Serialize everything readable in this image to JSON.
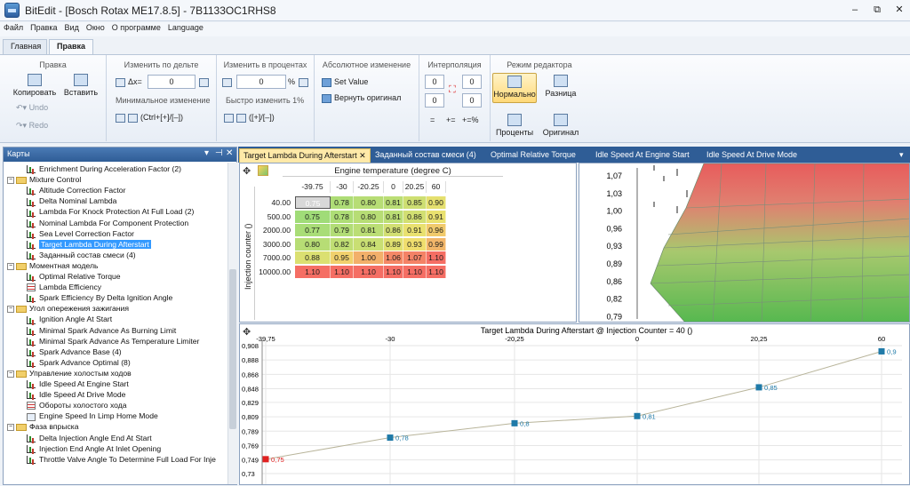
{
  "window": {
    "title": "BitEdit - [Bosch Rotax ME17.8.5] - 7B1133OC1RHS8",
    "min": "–",
    "restore": "⧉",
    "close": "✕"
  },
  "menu": [
    "Файл",
    "Правка",
    "Вид",
    "Окно",
    "О программе",
    "Language"
  ],
  "ribbon_tabs": [
    "Главная",
    "Правка"
  ],
  "ribbon": {
    "edit": {
      "title": "Правка",
      "copy": "Копировать",
      "paste": "Вставить",
      "undo": "Undo",
      "redo": "Redo"
    },
    "delta": {
      "title": "Изменить по дельте",
      "dx": "Δx=",
      "value": "0",
      "min_title": "Минимальное изменение",
      "shortcut": "(Ctrl+[+]/[–])"
    },
    "percent": {
      "title": "Изменить в процентах",
      "value": "0",
      "unit": "%",
      "quick_title": "Быстро изменить 1%",
      "shortcut": "([+]/[–])"
    },
    "absolute": {
      "title": "Абсолютное изменение",
      "set": "Set Value",
      "revert": "Вернуть оригинал"
    },
    "interp": {
      "title": "Интерполяция",
      "a": "0",
      "b": "0",
      "c": "0",
      "d": "0",
      "eq1": "=",
      "eq2": "+=",
      "eq3": "+=%"
    },
    "mode": {
      "title": "Режим редактора",
      "normal": "Нормально",
      "diff": "Разница",
      "percent": "Проценты",
      "orig": "Оригинал"
    }
  },
  "maps_panel": {
    "title": "Карты",
    "items": [
      {
        "t": "Enrichment During Acceleration Factor (2)",
        "lvl": 2,
        "icon": "chart"
      },
      {
        "t": "Mixture Control",
        "lvl": 1,
        "icon": "folder"
      },
      {
        "t": "Altitude Correction Factor",
        "lvl": 2,
        "icon": "chart"
      },
      {
        "t": "Delta Nominal Lambda",
        "lvl": 2,
        "icon": "chart"
      },
      {
        "t": "Lambda For Knock Protection At Full Load (2)",
        "lvl": 2,
        "icon": "chart"
      },
      {
        "t": "Nominal Lambda For Component Protection",
        "lvl": 2,
        "icon": "chart"
      },
      {
        "t": "Sea Level Correction Factor",
        "lvl": 2,
        "icon": "chart"
      },
      {
        "t": "Target Lambda During Afterstart",
        "lvl": 2,
        "icon": "chart",
        "sel": true
      },
      {
        "t": "Заданный состав смеси (4)",
        "lvl": 2,
        "icon": "chart"
      },
      {
        "t": "Моментная модель",
        "lvl": 1,
        "icon": "folder"
      },
      {
        "t": "Optimal Relative Torque",
        "lvl": 2,
        "icon": "chart"
      },
      {
        "t": "Lambda Efficiency",
        "lvl": 2,
        "icon": "table"
      },
      {
        "t": "Spark Efficiency By Delta Ignition Angle",
        "lvl": 2,
        "icon": "chart"
      },
      {
        "t": "Угол опережения зажигания",
        "lvl": 1,
        "icon": "folder"
      },
      {
        "t": "Ignition Angle At Start",
        "lvl": 2,
        "icon": "chart"
      },
      {
        "t": "Minimal Spark Advance As Burning Limit",
        "lvl": 2,
        "icon": "chart"
      },
      {
        "t": "Minimal Spark Advance As Temperature Limiter",
        "lvl": 2,
        "icon": "chart"
      },
      {
        "t": "Spark Advance Base (4)",
        "lvl": 2,
        "icon": "chart"
      },
      {
        "t": "Spark Advance Optimal (8)",
        "lvl": 2,
        "icon": "chart"
      },
      {
        "t": "Управление холостым ходов",
        "lvl": 1,
        "icon": "folder"
      },
      {
        "t": "Idle Speed At Engine Start",
        "lvl": 2,
        "icon": "chart"
      },
      {
        "t": "Idle Speed At Drive Mode",
        "lvl": 2,
        "icon": "chart"
      },
      {
        "t": "Обороты холостого хода",
        "lvl": 2,
        "icon": "table"
      },
      {
        "t": "Engine Speed In Limp Home Mode",
        "lvl": 2,
        "icon": "grid"
      },
      {
        "t": "Фаза впрыска",
        "lvl": 1,
        "icon": "folder"
      },
      {
        "t": "Delta Injection Angle End At Start",
        "lvl": 2,
        "icon": "chart"
      },
      {
        "t": "Injection End Angle At Inlet Opening",
        "lvl": 2,
        "icon": "chart"
      },
      {
        "t": "Throttle Valve Angle To Determine Full Load For Inje",
        "lvl": 2,
        "icon": "chart"
      }
    ]
  },
  "doc_tabs": [
    "Target Lambda During Afterstart",
    "Заданный состав смеси (4)",
    "Optimal Relative Torque",
    "Idle Speed At Engine Start",
    "Idle Speed At Drive Mode"
  ],
  "table": {
    "x_title": "Engine temperature (degree C)",
    "y_title": "Injection counter ()",
    "x": [
      "-39.75",
      "-30",
      "-20.25",
      "0",
      "20.25",
      "60"
    ],
    "y": [
      "40.00",
      "500.00",
      "2000.00",
      "3000.00",
      "7000.00",
      "10000.00"
    ],
    "cells": [
      [
        "0.75",
        "0.78",
        "0.80",
        "0.81",
        "0.85",
        "0.90"
      ],
      [
        "0.75",
        "0.78",
        "0.80",
        "0.81",
        "0.86",
        "0.91"
      ],
      [
        "0.77",
        "0.79",
        "0.81",
        "0.86",
        "0.91",
        "0.96"
      ],
      [
        "0.80",
        "0.82",
        "0.84",
        "0.89",
        "0.93",
        "0.99"
      ],
      [
        "0.88",
        "0.95",
        "1.00",
        "1.06",
        "1.07",
        "1.10"
      ],
      [
        "1.10",
        "1.10",
        "1.10",
        "1.10",
        "1.10",
        "1.10"
      ]
    ]
  },
  "view3d": {
    "axis": [
      "1,07",
      "1,03",
      "1,00",
      "0,96",
      "0,93",
      "0,89",
      "0,86",
      "0,82",
      "0,79"
    ]
  },
  "chart_data": {
    "type": "line",
    "title": "Target Lambda During Afterstart @ Injection Counter = 40 ()",
    "x": [
      -39.75,
      -30,
      -20.25,
      0,
      20.25,
      60
    ],
    "x_ticks": [
      "-39,75",
      "-30",
      "-20,25",
      "0",
      "20,25",
      "60"
    ],
    "values": [
      0.75,
      0.78,
      0.8,
      0.81,
      0.85,
      0.9
    ],
    "value_labels": [
      "0,75",
      "0,78",
      "0,8",
      "0,81",
      "0,85",
      "0,9"
    ],
    "y_ticks": [
      "0,908",
      "0,888",
      "0,868",
      "0,848",
      "0,829",
      "0,809",
      "0,789",
      "0,769",
      "0,749",
      "0,73"
    ],
    "ylim": [
      0.73,
      0.908
    ],
    "colors": {
      "line": "#b8b49a",
      "point": "#1f7aa8",
      "first": "#e02020"
    }
  },
  "move_glyph": "✥"
}
